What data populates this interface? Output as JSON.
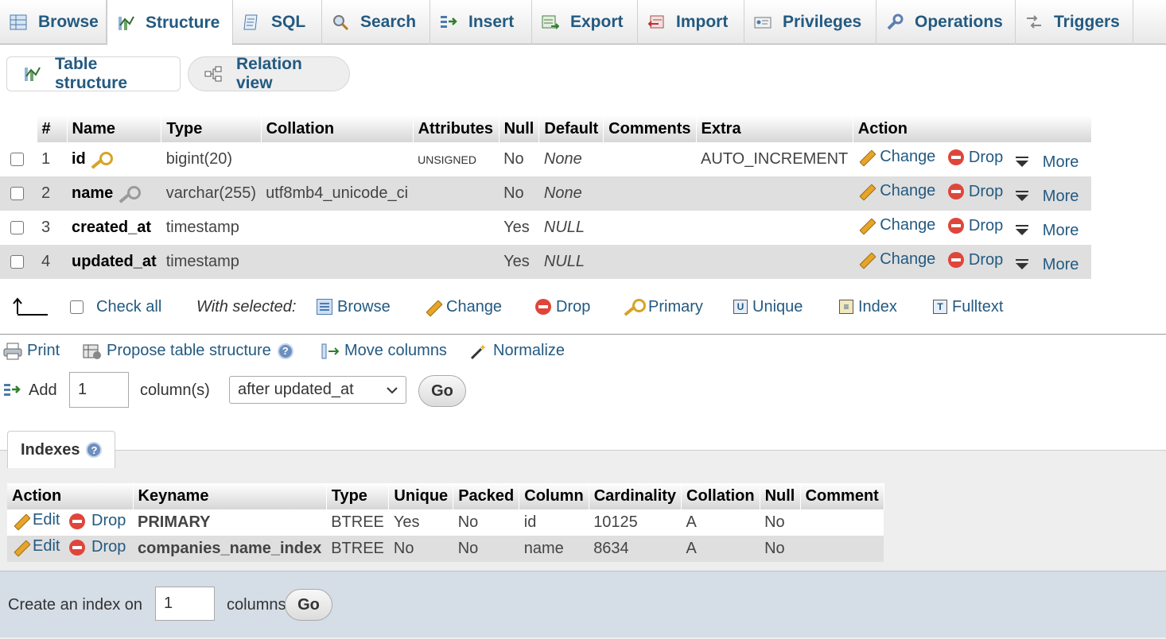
{
  "tabs": [
    {
      "label": "Browse",
      "icon": "table-icon"
    },
    {
      "label": "Structure",
      "icon": "structure-icon"
    },
    {
      "label": "SQL",
      "icon": "sql-icon"
    },
    {
      "label": "Search",
      "icon": "search-icon"
    },
    {
      "label": "Insert",
      "icon": "insert-icon"
    },
    {
      "label": "Export",
      "icon": "export-icon"
    },
    {
      "label": "Import",
      "icon": "import-icon"
    },
    {
      "label": "Privileges",
      "icon": "privileges-icon"
    },
    {
      "label": "Operations",
      "icon": "wrench-icon"
    },
    {
      "label": "Triggers",
      "icon": "triggers-icon"
    }
  ],
  "subtabs": {
    "table_structure": "Table structure",
    "relation_view": "Relation view"
  },
  "structure": {
    "headers": [
      "#",
      "Name",
      "Type",
      "Collation",
      "Attributes",
      "Null",
      "Default",
      "Comments",
      "Extra",
      "Action"
    ],
    "rows": [
      {
        "num": "1",
        "name": "id",
        "key": "primary",
        "type": "bigint(20)",
        "collation": "",
        "attributes": "UNSIGNED",
        "null": "No",
        "default": "None",
        "comments": "",
        "extra": "AUTO_INCREMENT"
      },
      {
        "num": "2",
        "name": "name",
        "key": "index",
        "type": "varchar(255)",
        "collation": "utf8mb4_unicode_ci",
        "attributes": "",
        "null": "No",
        "default": "None",
        "comments": "",
        "extra": ""
      },
      {
        "num": "3",
        "name": "created_at",
        "key": "",
        "type": "timestamp",
        "collation": "",
        "attributes": "",
        "null": "Yes",
        "default": "NULL",
        "comments": "",
        "extra": ""
      },
      {
        "num": "4",
        "name": "updated_at",
        "key": "",
        "type": "timestamp",
        "collation": "",
        "attributes": "",
        "null": "Yes",
        "default": "NULL",
        "comments": "",
        "extra": ""
      }
    ],
    "actions": {
      "change": "Change",
      "drop": "Drop",
      "more": "More"
    }
  },
  "with_selected": {
    "check_all": "Check all",
    "label": "With selected:",
    "browse": "Browse",
    "change": "Change",
    "drop": "Drop",
    "primary": "Primary",
    "unique": "Unique",
    "index": "Index",
    "fulltext": "Fulltext"
  },
  "tools": {
    "print": "Print",
    "propose": "Propose table structure",
    "move_columns": "Move columns",
    "normalize": "Normalize"
  },
  "add_column": {
    "label": "Add",
    "count": "1",
    "unit": "column(s)",
    "position": "after updated_at",
    "go": "Go"
  },
  "indexes": {
    "title": "Indexes",
    "headers": [
      "Action",
      "Keyname",
      "Type",
      "Unique",
      "Packed",
      "Column",
      "Cardinality",
      "Collation",
      "Null",
      "Comment"
    ],
    "edit": "Edit",
    "drop": "Drop",
    "rows": [
      {
        "keyname": "PRIMARY",
        "type": "BTREE",
        "unique": "Yes",
        "packed": "No",
        "column": "id",
        "cardinality": "10125",
        "collation": "A",
        "null": "No",
        "comment": ""
      },
      {
        "keyname": "companies_name_index",
        "type": "BTREE",
        "unique": "No",
        "packed": "No",
        "column": "name",
        "cardinality": "8634",
        "collation": "A",
        "null": "No",
        "comment": ""
      }
    ]
  },
  "create_index": {
    "label": "Create an index on",
    "count": "1",
    "unit": "columns",
    "go": "Go"
  },
  "colors": {
    "link": "#235a81",
    "row_even": "#dfdfdf",
    "indexes_bg": "#eeeeee",
    "create_bg": "#d5dde6"
  }
}
